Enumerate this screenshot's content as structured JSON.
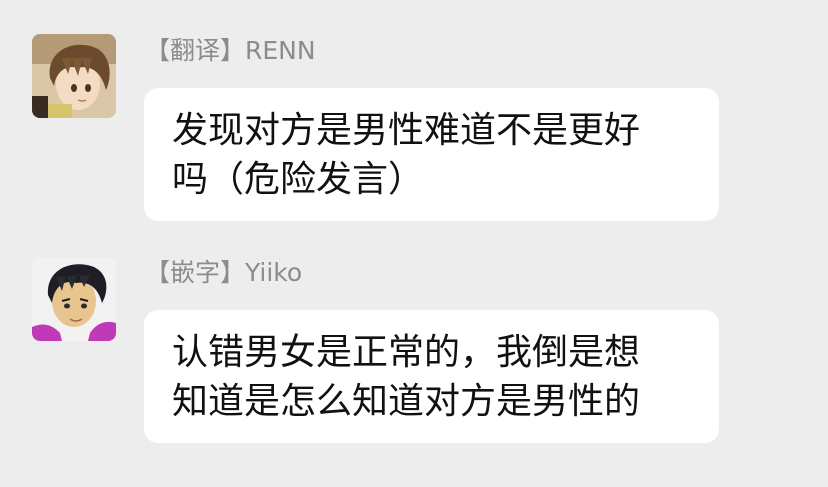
{
  "messages": [
    {
      "sender": "【翻译】RENN",
      "lines": [
        "发现对方是男性难道不是更好",
        "吗（危险发言）"
      ],
      "avatar_icon": "anime-boy-brown-hair-avatar"
    },
    {
      "sender": "【嵌字】Yiiko",
      "lines": [
        "认错男女是正常的，我倒是想",
        "知道是怎么知道对方是男性的"
      ],
      "avatar_icon": "anime-boy-dark-hair-avatar"
    }
  ],
  "colors": {
    "background": "#ededed",
    "bubble": "#ffffff",
    "sender_text": "#8c8c8c",
    "message_text": "#111111"
  }
}
